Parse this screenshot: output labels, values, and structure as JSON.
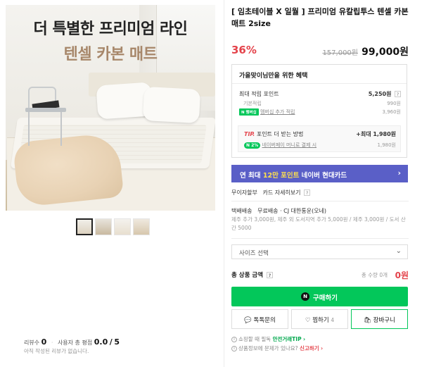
{
  "hero": {
    "headline": "더 특별한 프리미엄 라인",
    "subheadline": "텐셀 카본 매트"
  },
  "thumbnails": [
    "thumb1",
    "thumb2",
    "thumb3",
    "thumb4"
  ],
  "reviews": {
    "count_label": "리뷰수",
    "count": "0",
    "rating_label": "사용자 총 평점",
    "rating": "0.0",
    "rating_max": "5",
    "empty_note": "아직 작성된 리뷰가 없습니다."
  },
  "product": {
    "title": "[ 임초테이블 X 일월 ] 프리미엄 유칼립투스 텐셀 카본 매트 2size",
    "discount": "36%",
    "original_price": "157,000원",
    "price": "99,000원"
  },
  "benefits": {
    "heading": "가을맞이님만을 위한 혜택",
    "max_points_label": "최대 적립 포인트",
    "max_points_value": "5,250원",
    "basic_label": "기본적립",
    "basic_value": "990원",
    "npay_badge": "N 멤버십",
    "membership_label": "멤버십 추가 적립",
    "membership_value": "3,960원",
    "tip_tag": "TIP.",
    "tip_text": "포인트 더 받는 방법",
    "tip_value": "+최대 1,980원",
    "pct_badge": "N 2%",
    "npay_money_label": "네이버페이 머니로 결제 시",
    "npay_money_value": "1,980원"
  },
  "card_banner": {
    "prefix": "연 최대 ",
    "highlight": "12만 포인트",
    "suffix": " 네이버 현대카드",
    "arrow": "›"
  },
  "installment": {
    "label": "무이자할부",
    "detail": "카드 자세히보기"
  },
  "delivery": {
    "label": "택배배송",
    "value": "무료배송 · CJ 대한통운(오네)",
    "note": "제주 추가 3,000원, 제주 외 도서지역 추가 5,000원 / 제주 3,000원 / 도서 산간 5000"
  },
  "size_select": {
    "placeholder": "사이즈 선택"
  },
  "total": {
    "label": "총 상품 금액",
    "count": "총 수량 0개",
    "amount": "0원"
  },
  "buttons": {
    "buy": "구매하기",
    "buy_icon": "N",
    "talk": "톡톡문의",
    "wish": "찜하기",
    "wish_count": "4",
    "cart": "장바구니"
  },
  "footer": {
    "safe_text": "쇼핑할 때 필독",
    "safe_link": "안전거래TIP",
    "report_text": "상품정보에 문제가 있나요?",
    "report_link": "신고하기"
  },
  "colors": {
    "accent_green": "#03c75a",
    "discount_red": "#e4434b",
    "card_purple": "#5a5fc7"
  }
}
